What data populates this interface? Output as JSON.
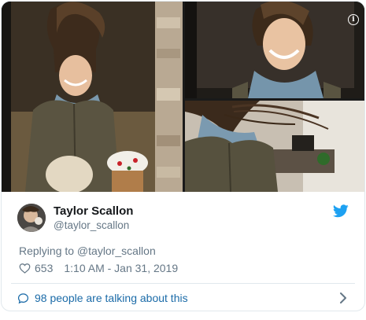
{
  "tweet": {
    "author_name": "Taylor Scallon",
    "author_handle": "@taylor_scallon",
    "replying_to": "Replying to @taylor_scallon",
    "likes": "653",
    "timestamp": "1:10 AM - Jan 31, 2019",
    "talking_text": "98 people are talking about this"
  },
  "icons": {
    "info": "info-icon",
    "bird": "twitter-bird-icon",
    "heart": "heart-icon",
    "bubble": "speech-bubble-icon",
    "chevron": "chevron-right-icon"
  },
  "colors": {
    "link_blue": "#1b6ba8",
    "twitter_blue": "#1da1f2",
    "muted_gray": "#657786",
    "border": "#e1e8ed"
  }
}
